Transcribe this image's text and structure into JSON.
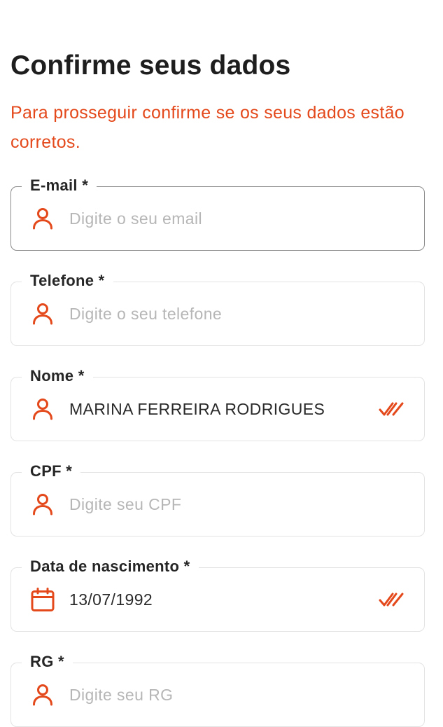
{
  "header": {
    "title": "Confirme seus dados",
    "subtitle": "Para prosseguir confirme se os seus dados estão corretos."
  },
  "colors": {
    "accent": "#e4491c",
    "border": "#e3e3e3",
    "focused_border": "#8a8a8a",
    "placeholder": "#b6b6b6"
  },
  "form": {
    "email": {
      "label": "E-mail *",
      "placeholder": "Digite o seu email",
      "value": "",
      "icon": "user-icon"
    },
    "phone": {
      "label": "Telefone *",
      "placeholder": "Digite o seu telefone",
      "value": "",
      "icon": "user-icon"
    },
    "name": {
      "label": "Nome *",
      "placeholder": "",
      "value": "MARINA FERREIRA RODRIGUES",
      "icon": "user-icon",
      "status_icon": "double-check-icon"
    },
    "cpf": {
      "label": "CPF *",
      "placeholder": "Digite seu CPF",
      "value": "",
      "icon": "user-icon"
    },
    "birthdate": {
      "label": "Data de nascimento *",
      "placeholder": "",
      "value": "13/07/1992",
      "icon": "calendar-icon",
      "status_icon": "double-check-icon"
    },
    "rg": {
      "label": "RG *",
      "placeholder": "Digite seu RG",
      "value": "",
      "icon": "user-icon"
    }
  }
}
